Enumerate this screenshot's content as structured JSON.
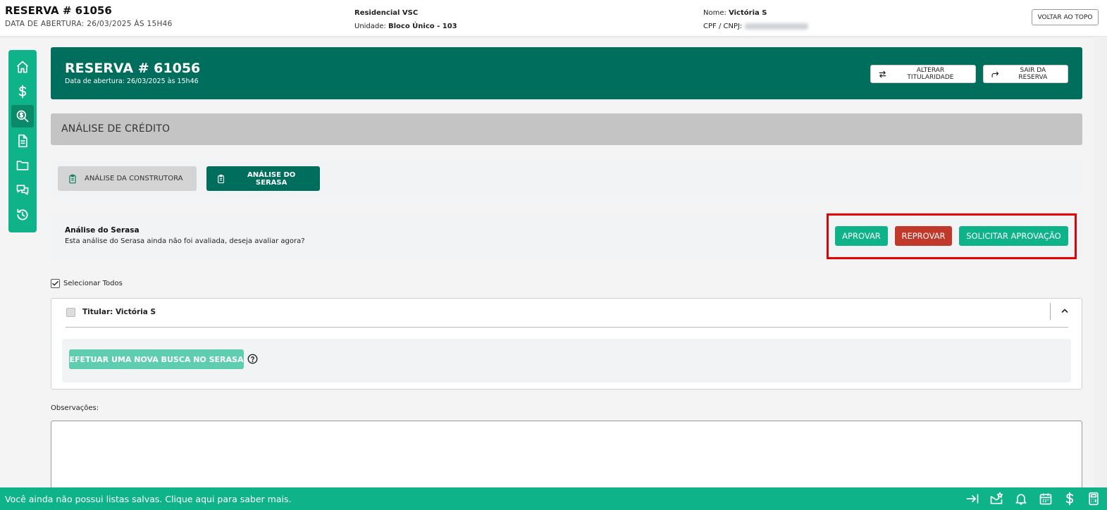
{
  "topbar": {
    "title": "RESERVA # 61056",
    "opening": "DATA DE ABERTURA: 26/03/2025 ÀS 15H46",
    "project": "Residencial VSC",
    "unit_label": "Unidade:",
    "unit_value": "Bloco Único - 103",
    "name_label": "Nome:",
    "name_value": "Victória S",
    "doc_label": "CPF / CNPJ:",
    "back_to_top": "VOLTAR AO TOPO"
  },
  "nav": {
    "items": [
      {
        "icon": "home-icon",
        "active": false
      },
      {
        "icon": "dollar-icon",
        "active": false
      },
      {
        "icon": "credit-analysis-icon",
        "active": true
      },
      {
        "icon": "document-icon",
        "active": false
      },
      {
        "icon": "folder-icon",
        "active": false
      },
      {
        "icon": "chat-icon",
        "active": false
      },
      {
        "icon": "history-icon",
        "active": false
      }
    ]
  },
  "hero": {
    "title": "RESERVA # 61056",
    "subtitle": "Data de abertura: 26/03/2025 às 15h46",
    "change_owner": "ALTERAR TITULARIDADE",
    "exit": "SAIR DA RESERVA"
  },
  "section": {
    "title": "ANÁLISE DE CRÉDITO"
  },
  "tabs": {
    "constructor": "ANÁLISE DA CONSTRUTORA",
    "serasa": "ANÁLISE DO SERASA"
  },
  "analysis": {
    "title": "Análise do Serasa",
    "text": "Esta análise do Serasa ainda não foi avaliada, deseja avaliar agora?",
    "approve": "APROVAR",
    "reject": "REPROVAR",
    "request": "SOLICITAR APROVAÇÃO"
  },
  "select_all": {
    "label": "Selecionar Todos",
    "checked": true
  },
  "holder": {
    "title": "Titular: Victória S",
    "new_search": "EFETUAR UMA NOVA BUSCA NO SERASA"
  },
  "observations": {
    "label": "Observações:",
    "value": ""
  },
  "bottombar": {
    "text": "Você ainda não possui listas salvas. Clique aqui para saber mais."
  },
  "colors": {
    "primary_dark": "#006e5c",
    "primary": "#0eb389",
    "danger": "#c0392b",
    "highlight": "#e60000"
  }
}
